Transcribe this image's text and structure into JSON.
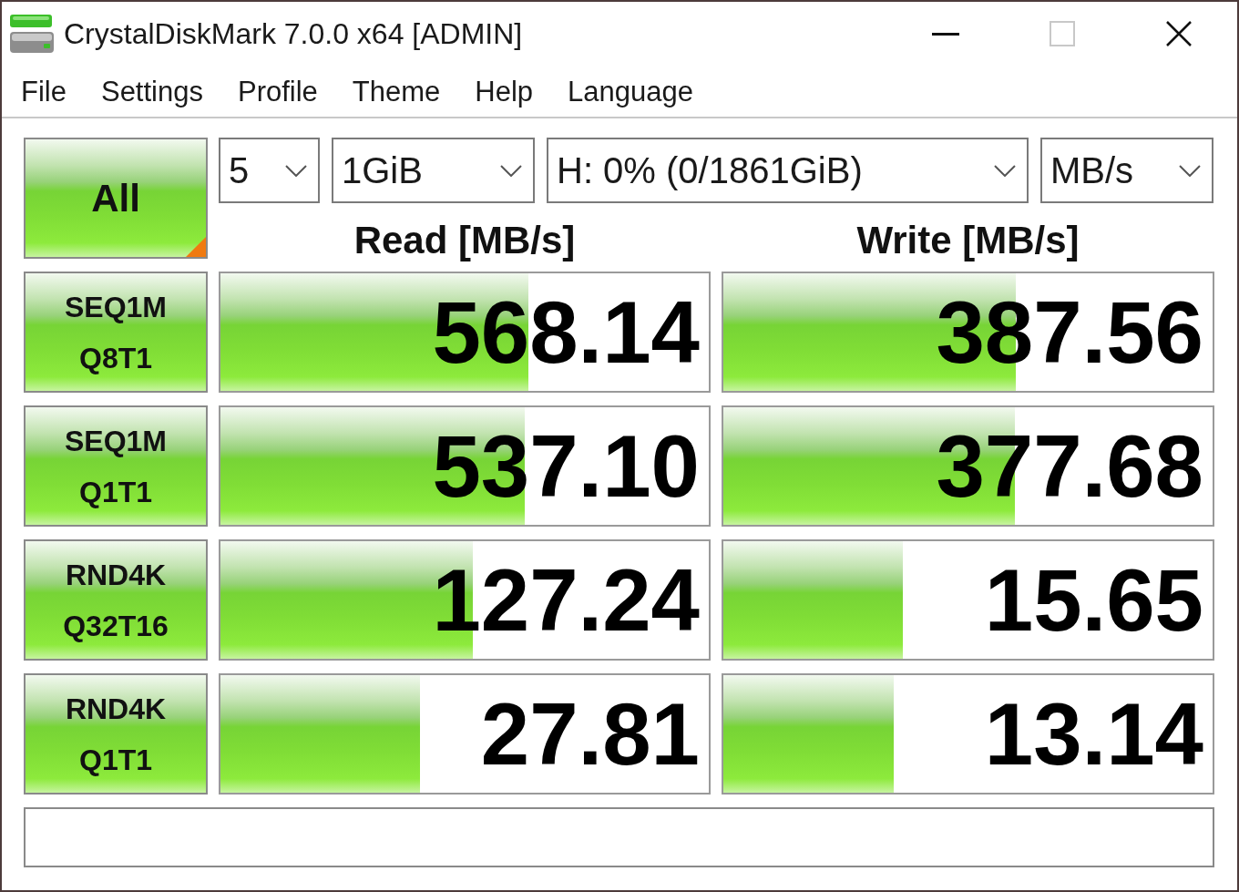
{
  "window": {
    "title": "CrystalDiskMark 7.0.0 x64 [ADMIN]",
    "controls": [
      {
        "kind": "minimize",
        "disabled": false
      },
      {
        "kind": "maximize",
        "disabled": true
      },
      {
        "kind": "close",
        "disabled": false
      }
    ]
  },
  "menu": [
    "File",
    "Settings",
    "Profile",
    "Theme",
    "Help",
    "Language"
  ],
  "toolbar": {
    "all_button": "All",
    "dropdowns": [
      {
        "value": "5"
      },
      {
        "value": "1GiB"
      },
      {
        "value": "H: 0% (0/1861GiB)"
      },
      {
        "value": "MB/s"
      }
    ]
  },
  "columns": [
    "Read [MB/s]",
    "Write [MB/s]"
  ],
  "tests": [
    {
      "lines": [
        "SEQ1M",
        "Q8T1"
      ],
      "read": {
        "value": "568.14",
        "level": 0.63
      },
      "write": {
        "value": "387.56",
        "level": 0.597
      }
    },
    {
      "lines": [
        "SEQ1M",
        "Q1T1"
      ],
      "read": {
        "value": "537.10",
        "level": 0.623
      },
      "write": {
        "value": "377.68",
        "level": 0.595
      }
    },
    {
      "lines": [
        "RND4K",
        "Q32T16"
      ],
      "read": {
        "value": "127.24",
        "level": 0.517
      },
      "write": {
        "value": "15.65",
        "level": 0.366
      }
    },
    {
      "lines": [
        "RND4K",
        "Q1T1"
      ],
      "read": {
        "value": "27.81",
        "level": 0.408
      },
      "write": {
        "value": "13.14",
        "level": 0.349
      }
    }
  ]
}
